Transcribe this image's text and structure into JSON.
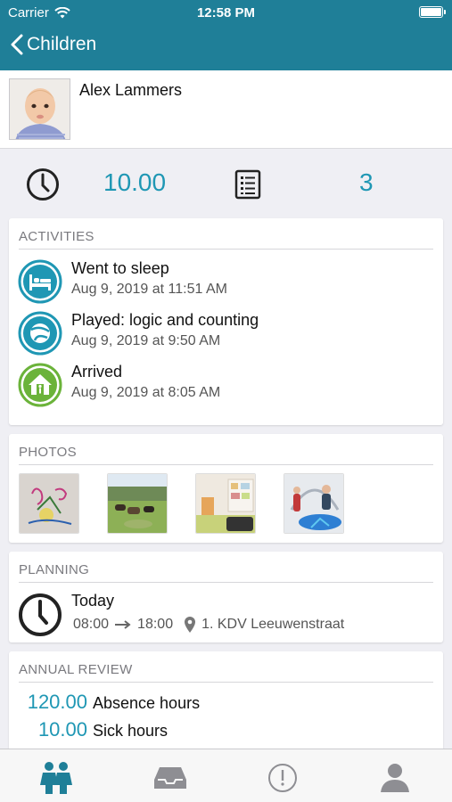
{
  "status_bar": {
    "carrier": "Carrier",
    "time": "12:58 PM"
  },
  "nav": {
    "back_label": "Children"
  },
  "profile": {
    "name": "Alex Lammers"
  },
  "stats": {
    "hours": "10.00",
    "count": "3"
  },
  "activities": {
    "header": "ACTIVITIES",
    "items": [
      {
        "title": "Went to sleep",
        "date": "Aug 9, 2019 at 11:51 AM",
        "icon": "bed-icon"
      },
      {
        "title": "Played: logic and counting",
        "date": "Aug 9, 2019 at 9:50 AM",
        "icon": "ball-icon"
      },
      {
        "title": "Arrived",
        "date": "Aug 9, 2019 at 8:05 AM",
        "icon": "house-icon"
      }
    ]
  },
  "photos": {
    "header": "PHOTOS"
  },
  "planning": {
    "header": "PLANNING",
    "day": "Today",
    "start": "08:00",
    "end": "18:00",
    "location": "1. KDV Leeuwenstraat"
  },
  "annual_review": {
    "header": "ANNUAL REVIEW",
    "rows": [
      {
        "value": "120.00",
        "label": "Absence hours"
      },
      {
        "value": "10.00",
        "label": "Sick hours"
      }
    ]
  },
  "colors": {
    "nav_bg": "#1f7f98",
    "accent": "#1f97b4",
    "arrived_green": "#6bb33a"
  }
}
